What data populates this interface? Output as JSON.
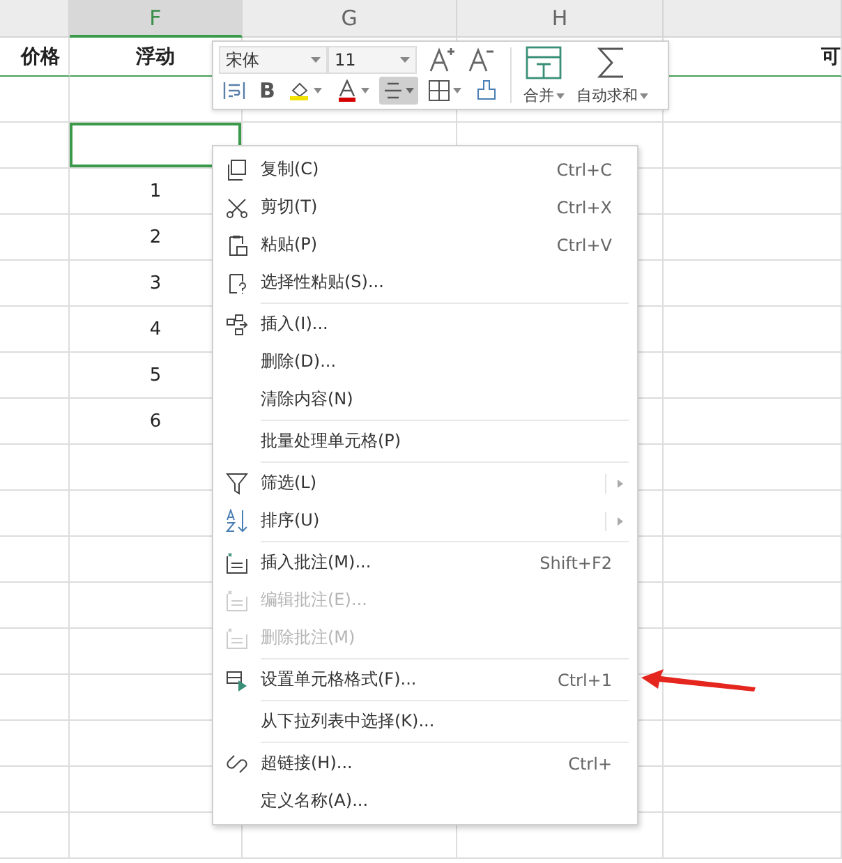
{
  "sheet": {
    "columns": [
      {
        "heading": "价格"
      },
      {
        "letter": "F",
        "selected": true,
        "heading": "浮动",
        "cells": [
          {
            "selected": false
          },
          {
            "selected": true
          },
          {
            "text": "1",
            "selected": false
          },
          {
            "text": "2",
            "selected": false
          },
          {
            "text": "3",
            "selected": false
          },
          {
            "text": "4",
            "selected": false
          },
          {
            "text": "5",
            "selected": false
          },
          {
            "text": "6",
            "selected": false
          }
        ]
      },
      {
        "letter": "G",
        "selected": false
      },
      {
        "letter": "H",
        "selected": false
      },
      {
        "heading": "可"
      }
    ]
  },
  "mini_toolbar": {
    "font": "宋体",
    "size": "11",
    "bold": "B",
    "format_buttons": [
      {
        "kind": "wrap",
        "selected": false
      },
      {
        "kind": "bold",
        "selected": false
      },
      {
        "kind": "fill",
        "selected": false
      },
      {
        "kind": "font-color",
        "selected": false
      },
      {
        "kind": "align",
        "selected": true
      },
      {
        "kind": "borders",
        "selected": false
      },
      {
        "kind": "brush",
        "selected": false
      }
    ],
    "merge": "合并",
    "autosum": "自动求和"
  },
  "context_menu": {
    "groups": [
      {
        "items": [
          {
            "label": "复制(C)",
            "shortcut": "Ctrl+C",
            "disabled": false
          },
          {
            "label": "剪切(T)",
            "shortcut": "Ctrl+X",
            "disabled": false
          },
          {
            "label": "粘贴(P)",
            "shortcut": "Ctrl+V",
            "disabled": false
          },
          {
            "label": "选择性粘贴(S)...",
            "disabled": false
          }
        ]
      },
      {
        "items": [
          {
            "label": "插入(I)...",
            "disabled": false
          },
          {
            "label": "删除(D)...",
            "disabled": false
          },
          {
            "label": "清除内容(N)",
            "disabled": false
          }
        ]
      },
      {
        "items": [
          {
            "label": "批量处理单元格(P)",
            "disabled": false
          }
        ]
      },
      {
        "items": [
          {
            "label": "筛选(L)",
            "disabled": false,
            "submenu": true
          },
          {
            "label": "排序(U)",
            "disabled": false,
            "submenu": true
          }
        ]
      },
      {
        "items": [
          {
            "label": "插入批注(M)...",
            "shortcut": "Shift+F2",
            "disabled": false
          },
          {
            "label": "编辑批注(E)...",
            "disabled": true
          },
          {
            "label": "删除批注(M)",
            "disabled": true
          }
        ]
      },
      {
        "items": [
          {
            "label": "设置单元格格式(F)...",
            "shortcut": "Ctrl+1",
            "disabled": false
          }
        ]
      },
      {
        "items": [
          {
            "label": "从下拉列表中选择(K)...",
            "disabled": false
          }
        ]
      },
      {
        "items": [
          {
            "label": "超链接(H)...",
            "shortcut": "Ctrl+",
            "disabled": false
          },
          {
            "label": "定义名称(A)...",
            "disabled": false
          }
        ]
      }
    ]
  }
}
